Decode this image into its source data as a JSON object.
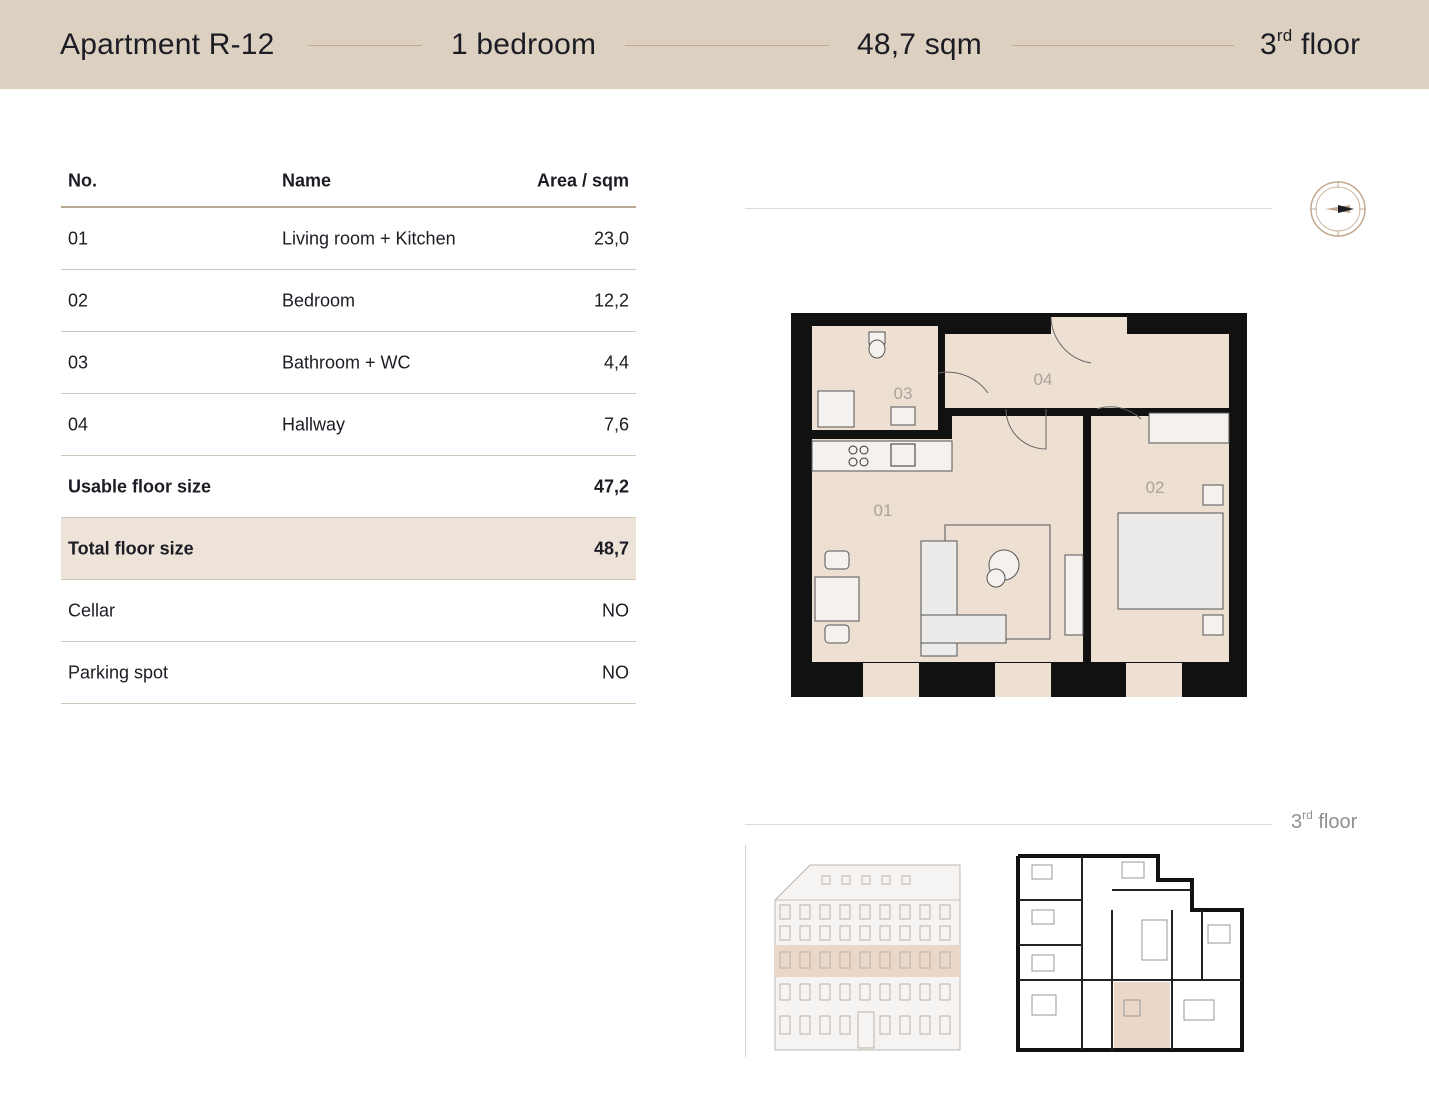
{
  "header": {
    "apartment": "Apartment R-12",
    "bedrooms": "1 bedroom",
    "area": "48,7 sqm",
    "floor_number": "3",
    "floor_suffix": "rd",
    "floor_word": "floor"
  },
  "table": {
    "columns": [
      "No.",
      "Name",
      "Area / sqm"
    ],
    "rooms": [
      {
        "no": "01",
        "name": "Living room + Kitchen",
        "area": "23,0"
      },
      {
        "no": "02",
        "name": "Bedroom",
        "area": "12,2"
      },
      {
        "no": "03",
        "name": "Bathroom + WC",
        "area": "4,4"
      },
      {
        "no": "04",
        "name": "Hallway",
        "area": "7,6"
      }
    ],
    "usable": {
      "label": "Usable floor size",
      "value": "47,2"
    },
    "total": {
      "label": "Total floor size",
      "value": "48,7"
    },
    "cellar": {
      "label": "Cellar",
      "value": "NO"
    },
    "parking": {
      "label": "Parking spot",
      "value": "NO"
    }
  },
  "plan": {
    "labels": {
      "r01": "01",
      "r02": "02",
      "r03": "03",
      "r04": "04"
    }
  },
  "floor_label": {
    "number": "3",
    "suffix": "rd",
    "word": "floor"
  },
  "colors": {
    "header_bg": "#dcd0c1",
    "room_fill": "#ede0d3",
    "wall": "#111111",
    "accent": "#c3a98f",
    "highlight_row": "#ede3d8"
  },
  "icons": [
    "compass-icon"
  ]
}
